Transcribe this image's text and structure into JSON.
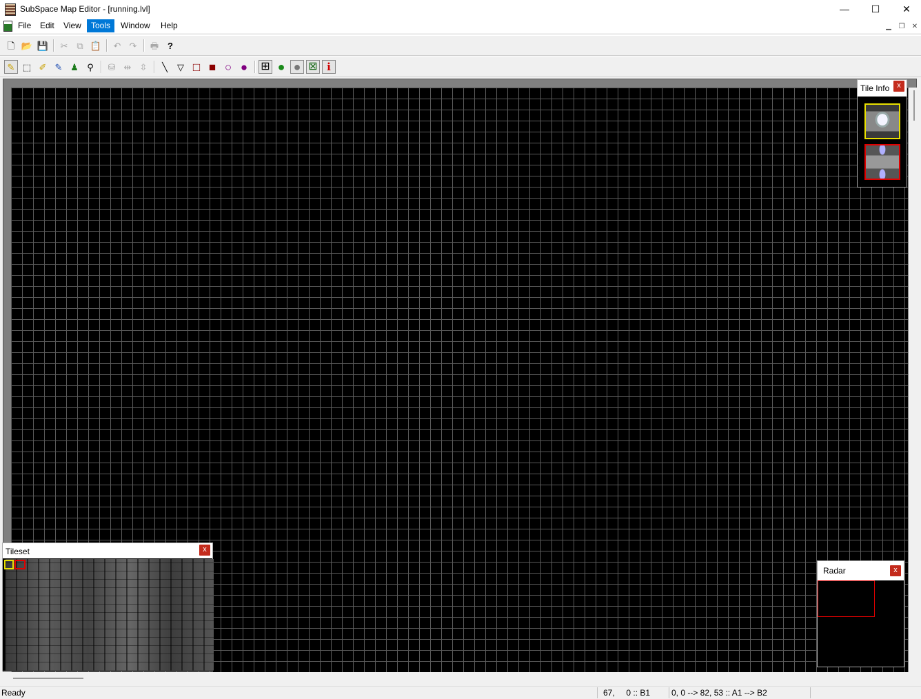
{
  "window": {
    "title": "SubSpace Map Editor - [running.lvl]",
    "minimize": "—",
    "maximize": "☐",
    "close": "✕"
  },
  "menubar": {
    "items": [
      "File",
      "Edit",
      "View",
      "Tools",
      "Window",
      "Help"
    ],
    "active": "Tools",
    "mdi_minimize": "▁",
    "mdi_restore": "❐",
    "mdi_close": "✕"
  },
  "toolbar1": {
    "new": "🗋",
    "open": "📂",
    "save": "💾",
    "cut": "✂",
    "copy": "⧉",
    "paste": "📋",
    "undo": "↶",
    "redo": "↷",
    "print": "🖶",
    "help": "?"
  },
  "toolbar2": {
    "pencil": "✎",
    "select": "⬚",
    "eyedropper": "✐",
    "fill": "✎",
    "stamp": "♟",
    "zoom": "⚲",
    "bucket": "⛁",
    "flip_h": "⇹",
    "flip_v": "⇳",
    "line": "╲",
    "triangle": "▽",
    "rect": "□",
    "rect_fill": "■",
    "ellipse": "○",
    "ellipse_fill": "●",
    "grid": "⊞",
    "green_ball": "●",
    "gray_ball": "●",
    "radar_toggle": "⊠",
    "info": "i"
  },
  "colors": {
    "tools_active": "#0078d7",
    "rect_red": "#8b0000",
    "ellipse_purple": "#800080",
    "green": "#1a8a1a",
    "info_red": "#d00000",
    "selection_yellow": "#e8e000",
    "selection_red": "#e00000"
  },
  "tile_info": {
    "title": "Tile Info",
    "close": "x"
  },
  "tileset": {
    "title": "Tileset",
    "close": "x"
  },
  "radar": {
    "title": "Radar",
    "close": "x"
  },
  "statusbar": {
    "ready": "Ready",
    "cursor": "67,     0 :: B1",
    "selection": "0, 0 --> 82, 53 :: A1 --> B2"
  }
}
